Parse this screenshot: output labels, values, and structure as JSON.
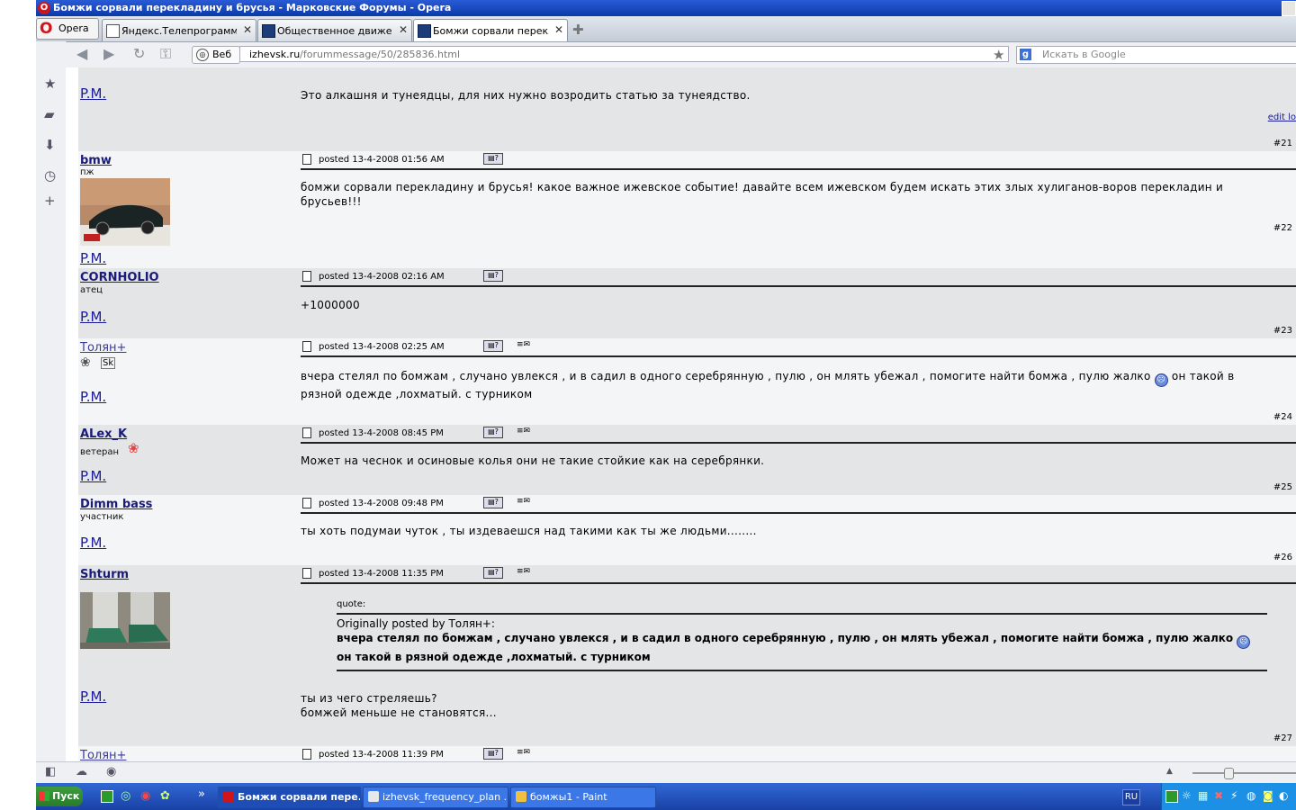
{
  "window": {
    "title": "Бомжи сорвали перекладину и брусья - Марковские Форумы - Opera"
  },
  "browser": {
    "menu_label": "Opera",
    "tabs": [
      {
        "label": "Яндекс.Телепрограмма..."
      },
      {
        "label": "Общественное движен..."
      },
      {
        "label": "Бомжи сорвали перекл..."
      }
    ],
    "web_button": "Веб",
    "url_domain": "izhevsk.ru",
    "url_path": "/forummessage/50/285836.html",
    "search_placeholder": "Искать в Google"
  },
  "forum": {
    "pm_label": "P.M.",
    "edit_label": "edit lo",
    "top_post": {
      "body": "Это алкашня и тунеядцы, для них нужно возродить статью за тунеядство.",
      "number": "#21"
    },
    "posts": [
      {
        "user": "bmw",
        "rank": "пж",
        "posted": "posted 13-4-2008 01:56 AM",
        "body": "бомжи сорвали перекладину и брусья! какое важное ижевское событие! давайте всем ижевском будем искать этих злых хулиганов-воров перекладин и брусьев!!!",
        "number": "#22"
      },
      {
        "user": "CORNHOLIO",
        "rank": "атец",
        "posted": "posted 13-4-2008 02:16 AM",
        "body": "+1000000",
        "number": "#23"
      },
      {
        "user": "Толян+",
        "rank": "",
        "posted": "posted 13-4-2008 02:25 AM",
        "body_a": "вчера стелял по бомжам , случано увлекся , и в садил в одного серебрянную , пулю , он млять убежал , помогите найти бомжа , пулю жалко",
        "body_b": "он такой в",
        "body_c": "рязной одежде ,лохматый. с турником",
        "number": "#24"
      },
      {
        "user": "ALex_K",
        "rank": "ветеран",
        "posted": "posted 13-4-2008 08:45 PM",
        "body": "Может на чеснок и осиновые колья они не такие стойкие как на серебрянки.",
        "number": "#25"
      },
      {
        "user": "Dimm bass",
        "rank": "участник",
        "posted": "posted 13-4-2008 09:48 PM",
        "body": "ты хоть подумаи чуток , ты издеваешся над такими как ты же людьми........",
        "number": "#26"
      },
      {
        "user": "Shturm",
        "rank": "",
        "posted": "posted 13-4-2008 11:35 PM",
        "quote_header": "quote:",
        "quote_by": "Originally posted by Толян+:",
        "quote_a": "вчера стелял по бомжам , случано увлекся , и в садил в одного серебрянную , пулю , он млять убежал , помогите найти бомжа , пулю",
        "quote_b": "жалко",
        "quote_c": "он такой в рязной одежде ,лохматый. с турником",
        "body_1": "ты из чего стреляешь?",
        "body_2": "бомжей меньше не становятся...",
        "number": "#27"
      },
      {
        "user": "Толян+",
        "posted": "posted 13-4-2008 11:39 PM"
      }
    ]
  },
  "taskbar": {
    "start_label": "Пуск",
    "tasks": [
      {
        "label": "Бомжи сорвали пере..."
      },
      {
        "label": "izhevsk_frequency_plan ..."
      },
      {
        "label": "бомжы1 - Paint"
      }
    ],
    "lang": "RU"
  }
}
